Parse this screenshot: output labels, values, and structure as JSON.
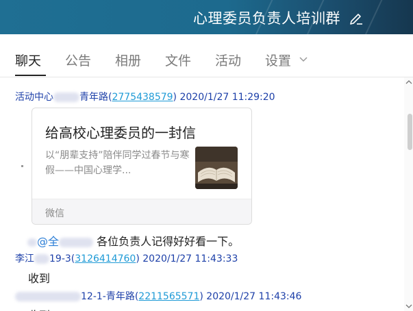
{
  "header": {
    "title": "心理委员负责人培训群",
    "edit_icon": "edit-pencil-icon"
  },
  "tabs": [
    {
      "label": "聊天",
      "active": true
    },
    {
      "label": "公告",
      "active": false
    },
    {
      "label": "相册",
      "active": false
    },
    {
      "label": "文件",
      "active": false
    },
    {
      "label": "活动",
      "active": false
    },
    {
      "label": "设置",
      "active": false,
      "dropdown_icon": "chevron-down-icon"
    }
  ],
  "messages": [
    {
      "sender_prefix": "活动中心",
      "sender_suffix": "青年路",
      "qq": "2775438579",
      "timestamp": "2020/1/27 11:29:20",
      "card": {
        "title": "给高校心理委员的一封信",
        "description": "以“朋辈支持”陪伴同学过春节与寒假——中国心理学...",
        "thumbnail_icon": "open-book-thumbnail",
        "source": "微信"
      }
    },
    {
      "mention": "@全",
      "text": "各位负责人记得好好看一下。"
    },
    {
      "sender_prefix": "李江",
      "sender_suffix": "19-3",
      "qq": "3126414760",
      "timestamp": "2020/1/27 11:43:33",
      "text": "收到"
    },
    {
      "sender_prefix": "",
      "sender_suffix": "12-1-青年路",
      "qq": "2211565571",
      "timestamp": "2020/1/27 11:43:46",
      "text": "收到"
    }
  ],
  "colors": {
    "header_bg": "#1f6f93",
    "sender_name": "#1c3fa8",
    "qq_link": "#1e9ad6",
    "card_source_bg": "#f5f5f7"
  }
}
